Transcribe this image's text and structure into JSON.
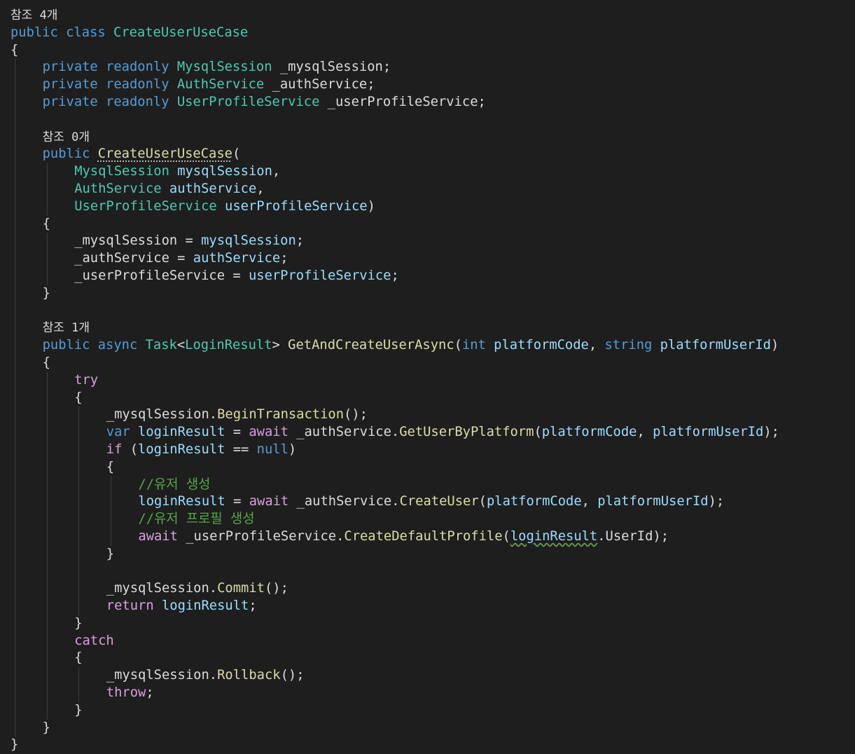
{
  "colors": {
    "background": "#1e1e1e",
    "plain": "#dcdcdc",
    "keyword": "#569cd6",
    "control": "#d8a0df",
    "type": "#4ec9b0",
    "method": "#dcdcaa",
    "parameter": "#9cdcfe",
    "comment": "#57a64a",
    "codelens": "#999999",
    "indent_guide": "#3c3c3c"
  },
  "editor": {
    "lines": [
      {
        "lens": true,
        "indent": 0,
        "tokens": [
          {
            "t": "참조 4개",
            "c": "lens"
          }
        ]
      },
      {
        "indent": 0,
        "tokens": [
          {
            "t": "public",
            "c": "kw"
          },
          {
            "t": " "
          },
          {
            "t": "class",
            "c": "kw"
          },
          {
            "t": " "
          },
          {
            "t": "CreateUserUseCase",
            "c": "type"
          }
        ]
      },
      {
        "indent": 0,
        "tokens": [
          {
            "t": "{"
          }
        ]
      },
      {
        "indent": 1,
        "tokens": [
          {
            "t": "private",
            "c": "kw"
          },
          {
            "t": " "
          },
          {
            "t": "readonly",
            "c": "kw"
          },
          {
            "t": " "
          },
          {
            "t": "MysqlSession",
            "c": "type"
          },
          {
            "t": " _mysqlSession;"
          }
        ]
      },
      {
        "indent": 1,
        "tokens": [
          {
            "t": "private",
            "c": "kw"
          },
          {
            "t": " "
          },
          {
            "t": "readonly",
            "c": "kw"
          },
          {
            "t": " "
          },
          {
            "t": "AuthService",
            "c": "type"
          },
          {
            "t": " _authService;"
          }
        ]
      },
      {
        "indent": 1,
        "tokens": [
          {
            "t": "private",
            "c": "kw"
          },
          {
            "t": " "
          },
          {
            "t": "readonly",
            "c": "kw"
          },
          {
            "t": " "
          },
          {
            "t": "UserProfileService",
            "c": "type"
          },
          {
            "t": " _userProfileService;"
          }
        ]
      },
      {
        "indent": 1,
        "tokens": []
      },
      {
        "lens": true,
        "indent": 1,
        "tokens": [
          {
            "t": "참조 0개",
            "c": "lens"
          }
        ]
      },
      {
        "indent": 1,
        "tokens": [
          {
            "t": "public",
            "c": "kw"
          },
          {
            "t": " "
          },
          {
            "t": "CreateUserUseCase",
            "c": "dots"
          },
          {
            "t": "("
          }
        ]
      },
      {
        "indent": 2,
        "tokens": [
          {
            "t": "MysqlSession",
            "c": "type"
          },
          {
            "t": " "
          },
          {
            "t": "mysqlSession",
            "c": "param"
          },
          {
            "t": ","
          }
        ]
      },
      {
        "indent": 2,
        "tokens": [
          {
            "t": "AuthService",
            "c": "type"
          },
          {
            "t": " "
          },
          {
            "t": "authService",
            "c": "param"
          },
          {
            "t": ","
          }
        ]
      },
      {
        "indent": 2,
        "tokens": [
          {
            "t": "UserProfileService",
            "c": "type"
          },
          {
            "t": " "
          },
          {
            "t": "userProfileService",
            "c": "param"
          },
          {
            "t": ")"
          }
        ]
      },
      {
        "indent": 1,
        "tokens": [
          {
            "t": "{"
          }
        ]
      },
      {
        "indent": 2,
        "tokens": [
          {
            "t": "_mysqlSession = "
          },
          {
            "t": "mysqlSession",
            "c": "param"
          },
          {
            "t": ";"
          }
        ]
      },
      {
        "indent": 2,
        "tokens": [
          {
            "t": "_authService = "
          },
          {
            "t": "authService",
            "c": "param"
          },
          {
            "t": ";"
          }
        ]
      },
      {
        "indent": 2,
        "tokens": [
          {
            "t": "_userProfileService = "
          },
          {
            "t": "userProfileService",
            "c": "param"
          },
          {
            "t": ";"
          }
        ]
      },
      {
        "indent": 1,
        "tokens": [
          {
            "t": "}"
          }
        ]
      },
      {
        "indent": 1,
        "tokens": []
      },
      {
        "lens": true,
        "indent": 1,
        "tokens": [
          {
            "t": "참조 1개",
            "c": "lens"
          }
        ]
      },
      {
        "indent": 1,
        "tokens": [
          {
            "t": "public",
            "c": "kw"
          },
          {
            "t": " "
          },
          {
            "t": "async",
            "c": "kw"
          },
          {
            "t": " "
          },
          {
            "t": "Task",
            "c": "type"
          },
          {
            "t": "<"
          },
          {
            "t": "LoginResult",
            "c": "type"
          },
          {
            "t": "> "
          },
          {
            "t": "GetAndCreateUserAsync",
            "c": "method"
          },
          {
            "t": "("
          },
          {
            "t": "int",
            "c": "kw"
          },
          {
            "t": " "
          },
          {
            "t": "platformCode",
            "c": "param"
          },
          {
            "t": ", "
          },
          {
            "t": "string",
            "c": "kw"
          },
          {
            "t": " "
          },
          {
            "t": "platformUserId",
            "c": "param"
          },
          {
            "t": ")"
          }
        ]
      },
      {
        "indent": 1,
        "tokens": [
          {
            "t": "{"
          }
        ]
      },
      {
        "indent": 2,
        "tokens": [
          {
            "t": "try",
            "c": "ctrl"
          }
        ]
      },
      {
        "indent": 2,
        "tokens": [
          {
            "t": "{"
          }
        ]
      },
      {
        "indent": 3,
        "tokens": [
          {
            "t": "_mysqlSession."
          },
          {
            "t": "BeginTransaction",
            "c": "method"
          },
          {
            "t": "();"
          }
        ]
      },
      {
        "indent": 3,
        "tokens": [
          {
            "t": "var",
            "c": "kw"
          },
          {
            "t": " "
          },
          {
            "t": "loginResult",
            "c": "param"
          },
          {
            "t": " = "
          },
          {
            "t": "await",
            "c": "ctrl"
          },
          {
            "t": " _authService."
          },
          {
            "t": "GetUserByPlatform",
            "c": "method"
          },
          {
            "t": "("
          },
          {
            "t": "platformCode",
            "c": "param"
          },
          {
            "t": ", "
          },
          {
            "t": "platformUserId",
            "c": "param"
          },
          {
            "t": ");"
          }
        ]
      },
      {
        "indent": 3,
        "tokens": [
          {
            "t": "if",
            "c": "ctrl"
          },
          {
            "t": " ("
          },
          {
            "t": "loginResult",
            "c": "param"
          },
          {
            "t": " == "
          },
          {
            "t": "null",
            "c": "kw"
          },
          {
            "t": ")"
          }
        ]
      },
      {
        "indent": 3,
        "tokens": [
          {
            "t": "{"
          }
        ]
      },
      {
        "indent": 4,
        "tokens": [
          {
            "t": "//유저 생성",
            "c": "comment"
          }
        ]
      },
      {
        "indent": 4,
        "tokens": [
          {
            "t": "loginResult",
            "c": "param"
          },
          {
            "t": " = "
          },
          {
            "t": "await",
            "c": "ctrl"
          },
          {
            "t": " _authService."
          },
          {
            "t": "CreateUser",
            "c": "method"
          },
          {
            "t": "("
          },
          {
            "t": "platformCode",
            "c": "param"
          },
          {
            "t": ", "
          },
          {
            "t": "platformUserId",
            "c": "param"
          },
          {
            "t": ");"
          }
        ]
      },
      {
        "indent": 4,
        "tokens": [
          {
            "t": "//유저 프로필 생성",
            "c": "comment"
          }
        ]
      },
      {
        "indent": 4,
        "tokens": [
          {
            "t": "await",
            "c": "ctrl"
          },
          {
            "t": " _userProfileService."
          },
          {
            "t": "CreateDefaultProfile",
            "c": "method"
          },
          {
            "t": "("
          },
          {
            "t": "loginResult",
            "c": "squiggle"
          },
          {
            "t": ".UserId);"
          }
        ]
      },
      {
        "indent": 3,
        "tokens": [
          {
            "t": "}"
          }
        ]
      },
      {
        "indent": 3,
        "tokens": []
      },
      {
        "indent": 3,
        "tokens": [
          {
            "t": "_mysqlSession."
          },
          {
            "t": "Commit",
            "c": "method"
          },
          {
            "t": "();"
          }
        ]
      },
      {
        "indent": 3,
        "tokens": [
          {
            "t": "return",
            "c": "ctrl"
          },
          {
            "t": " "
          },
          {
            "t": "loginResult",
            "c": "param"
          },
          {
            "t": ";"
          }
        ]
      },
      {
        "indent": 2,
        "tokens": [
          {
            "t": "}"
          }
        ]
      },
      {
        "indent": 2,
        "tokens": [
          {
            "t": "catch",
            "c": "ctrl"
          }
        ]
      },
      {
        "indent": 2,
        "tokens": [
          {
            "t": "{"
          }
        ]
      },
      {
        "indent": 3,
        "tokens": [
          {
            "t": "_mysqlSession."
          },
          {
            "t": "Rollback",
            "c": "method"
          },
          {
            "t": "();"
          }
        ]
      },
      {
        "indent": 3,
        "tokens": [
          {
            "t": "throw",
            "c": "ctrl"
          },
          {
            "t": ";"
          }
        ]
      },
      {
        "indent": 2,
        "tokens": [
          {
            "t": "}"
          }
        ]
      },
      {
        "indent": 1,
        "tokens": [
          {
            "t": "}"
          }
        ]
      },
      {
        "indent": 0,
        "tokens": [
          {
            "t": "}"
          }
        ]
      }
    ]
  }
}
